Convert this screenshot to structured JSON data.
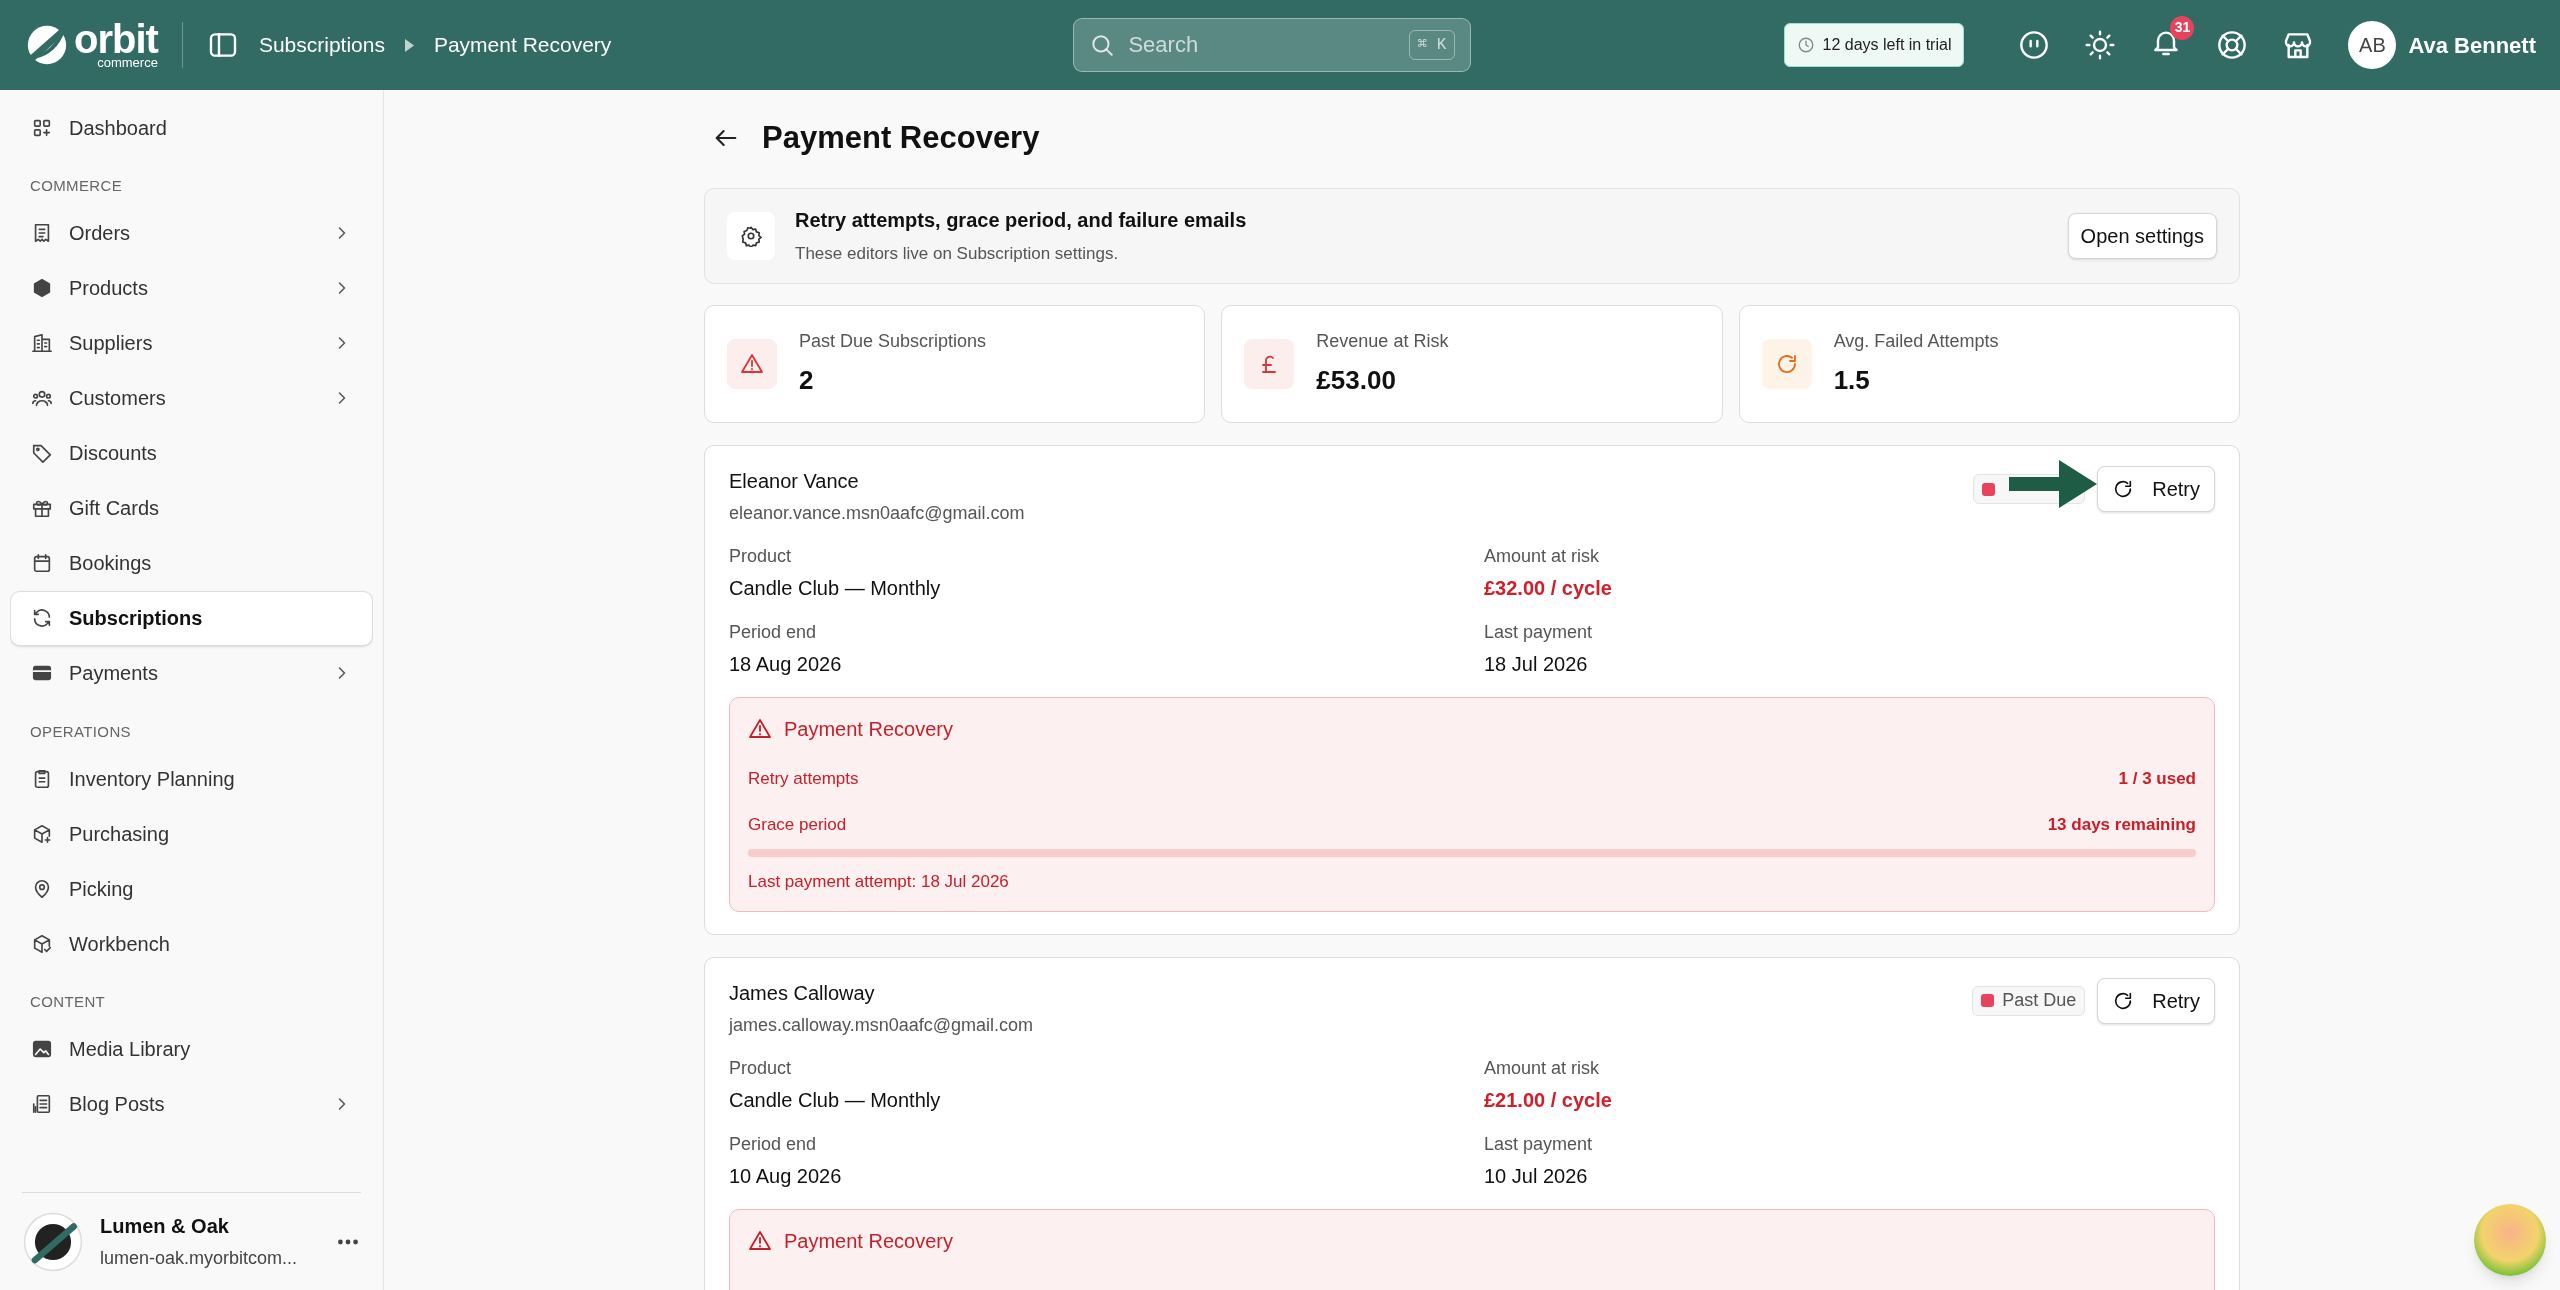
{
  "header": {
    "logo": {
      "word": "orbit",
      "sub": "commerce"
    },
    "breadcrumb": [
      "Subscriptions",
      "Payment Recovery"
    ],
    "search": {
      "placeholder": "Search",
      "shortcut": "⌘ K"
    },
    "trial": "12 days left in trial",
    "notifications": "31",
    "user": {
      "initials": "AB",
      "name": "Ava Bennett"
    }
  },
  "sidebar": {
    "sections": [
      {
        "items": [
          {
            "label": "Dashboard",
            "submenu": false,
            "selected": false
          }
        ]
      },
      {
        "heading": "COMMERCE",
        "items": [
          {
            "label": "Orders",
            "submenu": true,
            "selected": false
          },
          {
            "label": "Products",
            "submenu": true,
            "selected": false
          },
          {
            "label": "Suppliers",
            "submenu": true,
            "selected": false
          },
          {
            "label": "Customers",
            "submenu": true,
            "selected": false
          },
          {
            "label": "Discounts",
            "submenu": false,
            "selected": false
          },
          {
            "label": "Gift Cards",
            "submenu": false,
            "selected": false
          },
          {
            "label": "Bookings",
            "submenu": false,
            "selected": false
          },
          {
            "label": "Subscriptions",
            "submenu": false,
            "selected": true
          },
          {
            "label": "Payments",
            "submenu": true,
            "selected": false
          }
        ]
      },
      {
        "heading": "OPERATIONS",
        "items": [
          {
            "label": "Inventory Planning",
            "submenu": false,
            "selected": false
          },
          {
            "label": "Purchasing",
            "submenu": false,
            "selected": false
          },
          {
            "label": "Picking",
            "submenu": false,
            "selected": false
          },
          {
            "label": "Workbench",
            "submenu": false,
            "selected": false
          }
        ]
      },
      {
        "heading": "CONTENT",
        "items": [
          {
            "label": "Media Library",
            "submenu": false,
            "selected": false
          },
          {
            "label": "Blog Posts",
            "submenu": true,
            "selected": false
          }
        ]
      }
    ],
    "store": {
      "name": "Lumen & Oak",
      "domain": "lumen-oak.myorbitcom..."
    }
  },
  "page": {
    "title": "Payment Recovery",
    "notice": {
      "title": "Retry attempts, grace period, and failure emails",
      "text": "These editors live on Subscription settings.",
      "button": "Open settings"
    },
    "stats": [
      {
        "label": "Past Due Subscriptions",
        "value": "2",
        "kind": "warning"
      },
      {
        "label": "Revenue at Risk",
        "value": "£53.00",
        "kind": "currency"
      },
      {
        "label": "Avg. Failed Attempts",
        "value": "1.5",
        "kind": "retry"
      }
    ],
    "subscriptions": [
      {
        "name": "Eleanor Vance",
        "email": "eleanor.vance.msn0aafc@gmail.com",
        "status": {
          "color": "#e8435d"
        },
        "covered_by_arrow": true,
        "button": "Retry",
        "fields": [
          {
            "label": "Product",
            "value": "Candle Club — Monthly",
            "kind": "plain"
          },
          {
            "label": "Amount at risk",
            "value": "£32.00 / cycle",
            "kind": "risk"
          },
          {
            "label": "Period end",
            "value": "18 Aug 2026",
            "kind": "plain"
          },
          {
            "label": "Last payment",
            "value": "18 Jul 2026",
            "kind": "plain"
          }
        ],
        "recovery": {
          "title": "Payment Recovery",
          "rows": [
            {
              "label": "Retry attempts",
              "value": "1 / 3 used"
            },
            {
              "label": "Grace period",
              "value": "13 days remaining"
            }
          ],
          "grace_bar": true,
          "last_attempt": "Last payment attempt: 18 Jul 2026"
        }
      },
      {
        "name": "James Calloway",
        "email": "james.calloway.msn0aafc@gmail.com",
        "status": {
          "label": "Past Due",
          "color": "#e8435d"
        },
        "covered_by_arrow": false,
        "button": "Retry",
        "fields": [
          {
            "label": "Product",
            "value": "Candle Club — Monthly",
            "kind": "plain"
          },
          {
            "label": "Amount at risk",
            "value": "£21.00 / cycle",
            "kind": "risk"
          },
          {
            "label": "Period end",
            "value": "10 Aug 2026",
            "kind": "plain"
          },
          {
            "label": "Last payment",
            "value": "10 Jul 2026",
            "kind": "plain"
          }
        ],
        "recovery": {
          "title": "Payment Recovery"
        }
      }
    ]
  }
}
